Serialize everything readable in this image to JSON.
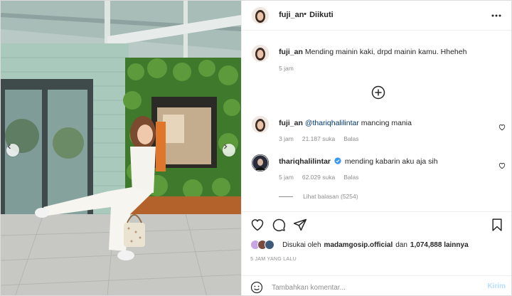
{
  "post": {
    "author": "fuji_an",
    "follow_status": "Diikuti",
    "header_dot": "•"
  },
  "caption": {
    "username": "fuji_an",
    "text": "Mending mainin kaki, drpd mainin kamu. Hheheh",
    "time": "5 jam"
  },
  "comments": [
    {
      "username": "fuji_an",
      "mention": "@thariqhalilintar",
      "text": "mancing mania",
      "time": "3 jam",
      "likes": "21.187 suka",
      "reply": "Balas"
    },
    {
      "username": "thariqhalilintar",
      "verified": true,
      "text": "mending kabarin aku aja sih",
      "time": "5 jam",
      "likes": "62.029 suka",
      "reply": "Balas"
    }
  ],
  "view_replies": "Lihat balasan (5254)",
  "likes": {
    "prefix": "Disukai oleh",
    "user": "madamgosip.official",
    "middle": "dan",
    "count": "1,074,888 lainnya"
  },
  "timestamp": "5 JAM YANG LALU",
  "composer": {
    "placeholder": "Tambahkan komentar...",
    "post_label": "Kirim"
  },
  "colors": {
    "accent_blue": "#0095f6",
    "verified_blue": "#3897f0",
    "muted": "#8e8e8e",
    "post_disabled": "#b2dffc"
  },
  "icons": {
    "more": "more-icon",
    "load_more": "plus-circle-icon",
    "heart": "heart-icon",
    "comment": "comment-icon",
    "share": "share-icon",
    "save": "bookmark-icon",
    "emoji": "emoji-icon",
    "verified": "verified-badge-icon",
    "prev": "chevron-left-icon",
    "next": "chevron-right-icon"
  }
}
